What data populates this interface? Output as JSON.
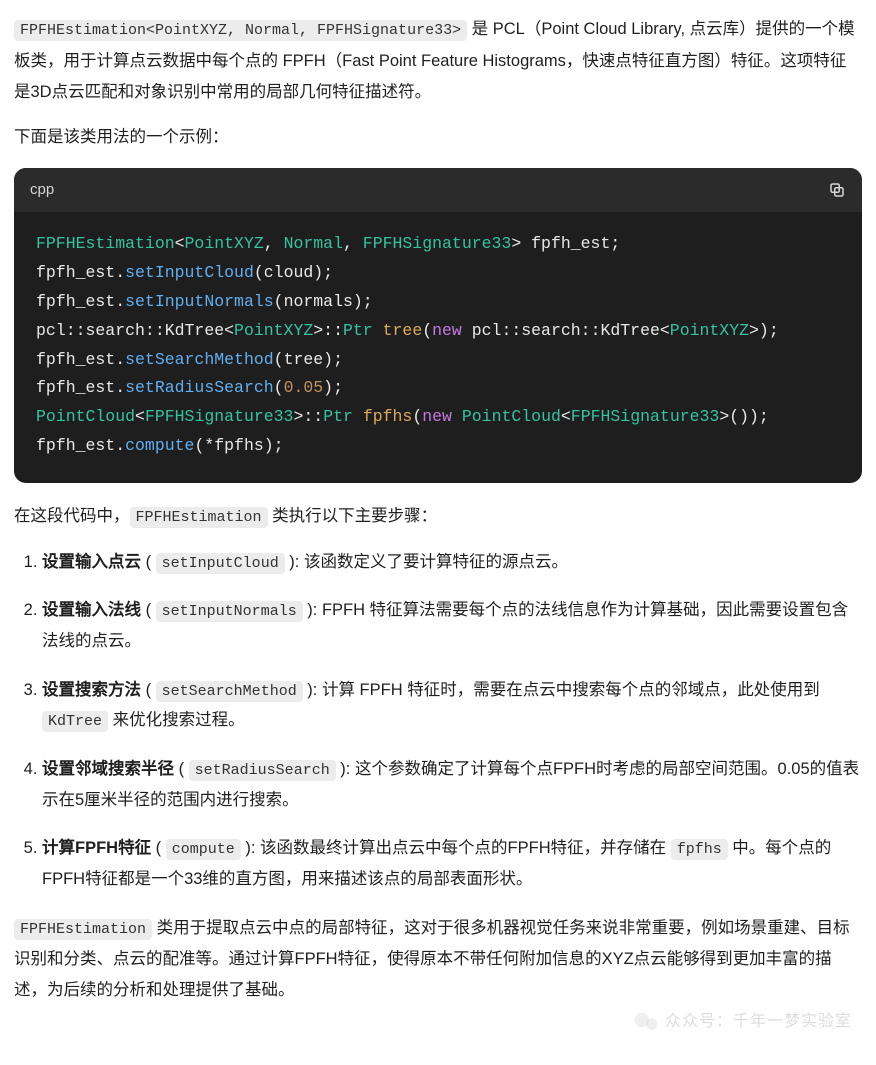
{
  "intro": {
    "code1": "FPFHEstimation<PointXYZ, Normal, FPFHSignature33>",
    "p1_after": " 是 PCL（Point Cloud Library, 点云库）提供的一个模板类，用于计算点云数据中每个点的 FPFH（Fast Point Feature Histograms，快速点特征直方图）特征。这项特征是3D点云匹配和对象识别中常用的局部几何特征描述符。",
    "p2": "下面是该类用法的一个示例："
  },
  "code_block": {
    "lang": "cpp",
    "l1": {
      "t1": "FPFHEstimation",
      "lt": "<",
      "t2": "PointXYZ",
      "c1": ", ",
      "t3": "Normal",
      "c2": ", ",
      "t4": "FPFHSignature33",
      "gt": ">",
      "sp": " ",
      "v": "fpfh_est",
      "sc": ";"
    },
    "l2": {
      "obj": "fpfh_est",
      "dot": ".",
      "fn": "setInputCloud",
      "op": "(",
      "arg": "cloud",
      "cp": ");"
    },
    "l3": {
      "obj": "fpfh_est",
      "dot": ".",
      "fn": "setInputNormals",
      "op": "(",
      "arg": "normals",
      "cp": ");"
    },
    "l4": {
      "ns": "pcl::search::KdTree",
      "lt": "<",
      "t": "PointXYZ",
      "gt": ">::",
      "ptr": "Ptr",
      "sp": " ",
      "name": "tree",
      "op": "(",
      "kw": "new",
      "sp2": " ",
      "ns2": "pcl::search::KdTree",
      "lt2": "<",
      "t2": "PointXYZ",
      "gt2": ">);"
    },
    "l5": {
      "obj": "fpfh_est",
      "dot": ".",
      "fn": "setSearchMethod",
      "op": "(",
      "arg": "tree",
      "cp": ");"
    },
    "l6": {
      "obj": "fpfh_est",
      "dot": ".",
      "fn": "setRadiusSearch",
      "op": "(",
      "num": "0.05",
      "cp": ");"
    },
    "l7": {
      "ns": "PointCloud",
      "lt": "<",
      "t": "FPFHSignature33",
      "gt": ">::",
      "ptr": "Ptr",
      "sp": " ",
      "name": "fpfhs",
      "op": "(",
      "kw": "new",
      "sp2": " ",
      "ns2": "PointCloud",
      "lt2": "<",
      "t2": "FPFHSignature33",
      "gt2": ">());"
    },
    "l8": {
      "obj": "fpfh_est",
      "dot": ".",
      "fn": "compute",
      "op": "(*",
      "arg": "fpfhs",
      "cp": ");"
    }
  },
  "mid": {
    "before": "在这段代码中，",
    "code": "FPFHEstimation",
    "after": " 类执行以下主要步骤："
  },
  "list": [
    {
      "title": "设置输入点云",
      "open": " ( ",
      "code": "setInputCloud",
      "close": " ): ",
      "rest": "该函数定义了要计算特征的源点云。"
    },
    {
      "title": "设置输入法线",
      "open": " ( ",
      "code": "setInputNormals",
      "close": " ): ",
      "rest": "FPFH 特征算法需要每个点的法线信息作为计算基础，因此需要设置包含法线的点云。"
    },
    {
      "title": "设置搜索方法",
      "open": " ( ",
      "code": "setSearchMethod",
      "close": " ): ",
      "rest_a": "计算 FPFH 特征时，需要在点云中搜索每个点的邻域点，此处使用到 ",
      "code2": "KdTree",
      "rest_b": " 来优化搜索过程。"
    },
    {
      "title": "设置邻域搜索半径",
      "open": " ( ",
      "code": "setRadiusSearch",
      "close": " ): ",
      "rest": "这个参数确定了计算每个点FPFH时考虑的局部空间范围。0.05的值表示在5厘米半径的范围内进行搜索。"
    },
    {
      "title": "计算FPFH特征",
      "open": " ( ",
      "code": "compute",
      "close": " ): ",
      "rest_a": "该函数最终计算出点云中每个点的FPFH特征，并存储在 ",
      "code2": "fpfhs",
      "rest_b": " 中。每个点的FPFH特征都是一个33维的直方图，用来描述该点的局部表面形状。"
    }
  ],
  "outro": {
    "code": "FPFHEstimation",
    "text": " 类用于提取点云中点的局部特征，这对于很多机器视觉任务来说非常重要，例如场景重建、目标识别和分类、点云的配准等。通过计算FPFH特征，使得原本不带任何附加信息的XYZ点云能够得到更加丰富的描述，为后续的分析和处理提供了基础。"
  },
  "watermark": "众众号：千年一梦实验室"
}
